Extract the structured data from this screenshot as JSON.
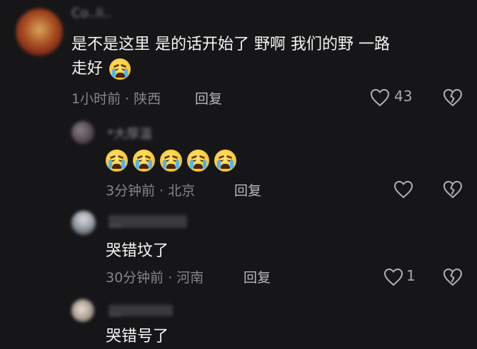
{
  "comments": [
    {
      "name": "Co..li..",
      "text_line1": "是不是这里 是的话开始了 野啊 我们的野 一路",
      "text_line2": "走好",
      "meta": "1小时前 · 陕西",
      "reply": "回复",
      "likes": "43",
      "emoji": "loudly-crying-face"
    },
    {
      "name": "*大厚温",
      "emoji_count": 5,
      "emoji": "loudly-crying-face",
      "meta": "3分钟前 · 北京",
      "reply": "回复",
      "likes": ""
    },
    {
      "name": "...",
      "text": "哭错坟了",
      "meta": "30分钟前 · 河南",
      "reply": "回复",
      "likes": "1"
    },
    {
      "name": "...",
      "text": "哭错号了"
    }
  ],
  "icons": {
    "like": "heart-outline-icon",
    "dislike": "broken-heart-icon"
  },
  "colors": {
    "background": "#161618",
    "text": "#f4f4f4",
    "meta": "#86868b"
  }
}
